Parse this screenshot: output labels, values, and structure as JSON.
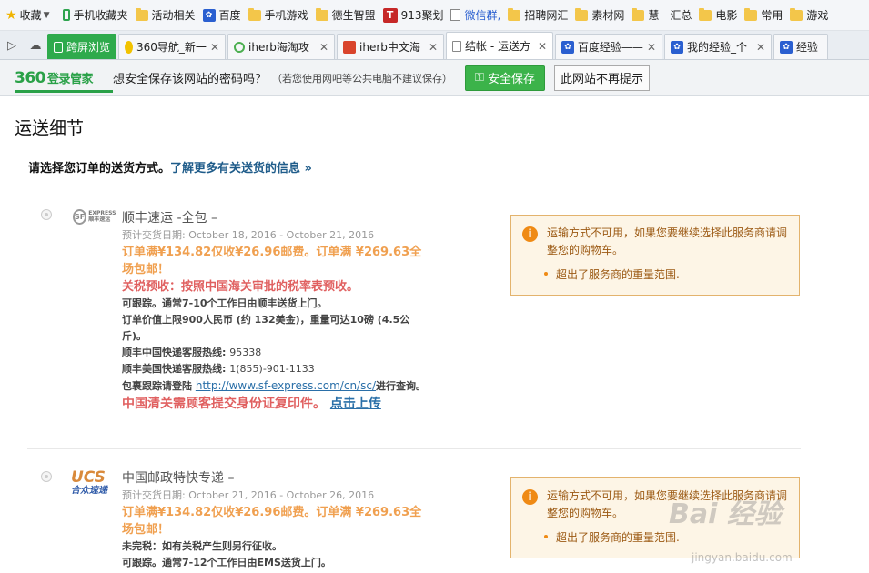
{
  "bookmarks": [
    {
      "label": "收藏",
      "icon": "star-icon"
    },
    {
      "label": "手机收藏夹",
      "icon": "phone-icon"
    },
    {
      "label": "活动相关",
      "icon": "folder-icon"
    },
    {
      "label": "百度",
      "icon": "baidu-paw-icon"
    },
    {
      "label": "手机游戏",
      "icon": "folder-icon"
    },
    {
      "label": "德生智盟",
      "icon": "folder-icon"
    },
    {
      "label": "913聚划",
      "icon": "t-icon"
    },
    {
      "label": "微信群,",
      "icon": "doc-icon"
    },
    {
      "label": "招聘网汇",
      "icon": "folder-icon"
    },
    {
      "label": "素材网",
      "icon": "folder-icon"
    },
    {
      "label": "慧一汇总",
      "icon": "folder-icon"
    },
    {
      "label": "电影",
      "icon": "folder-icon"
    },
    {
      "label": "常用",
      "icon": "folder-icon"
    },
    {
      "label": "游戏",
      "icon": "folder-icon"
    }
  ],
  "tabs": [
    {
      "label": "跨屏浏览"
    },
    {
      "label": "360导航_新一"
    },
    {
      "label": "iherb海淘攻"
    },
    {
      "label": "iherb中文海"
    },
    {
      "label": "结帐 - 运送方"
    },
    {
      "label": "百度经验——"
    },
    {
      "label": "我的经验_个"
    },
    {
      "label": "经验"
    }
  ],
  "password_bar": {
    "brand": "360",
    "brand_sub": "登录管家",
    "message": "想安全保存该网站的密码吗？",
    "note": "（若您使用网吧等公共电脑不建议保存）",
    "save_label": "安全保存",
    "never_label": "此网站不再提示"
  },
  "page": {
    "title": "运送细节",
    "intro": "请选择您订单的送货方式。",
    "intro_link": "了解更多有关送货的信息 »"
  },
  "shipping_options": [
    {
      "name": "顺丰速运 -全包 –",
      "date": "预计交货日期: October 18, 2016 - October 21, 2016",
      "promo": "订单满¥134.82仅收¥26.96邮费。订单满 ¥269.63全场包邮！",
      "tax": "关税预收：按照中国海关审批的税率表预收。",
      "tracking": "可跟踪。通常7-10个工作日由顺丰送货上门。",
      "limit": "订单价值上限900人民币 (约 132美金)，重量可达10磅 (4.5公斤)。",
      "hotline_cn_label": "顺丰中国快递客服热线:",
      "hotline_cn": "95338",
      "hotline_us_label": "顺丰美国快递客服热线:",
      "hotline_us": "1(855)-901-1133",
      "track_prefix": "包裹跟踪请登陆",
      "track_url": "http://www.sf-express.com/cn/sc/",
      "track_suffix": "进行查询。",
      "id_notice": "中国清关需顾客提交身份证复印件。",
      "upload_link": "点击上传",
      "logo_text": "SF",
      "logo_sub": "EXPRESS\n顺丰速运"
    },
    {
      "name": "中国邮政特快专递 –",
      "date": "预计交货日期: October 21, 2016 - October 26, 2016",
      "promo": "订单满¥134.82仅收¥26.96邮费。订单满 ¥269.63全场包邮！",
      "tax": "未完税：如有关税产生则另行征收。",
      "tracking": "可跟踪。通常7-12个工作日由EMS送货上门。",
      "logo_text": "UCS",
      "logo_sub": "合众速递"
    }
  ],
  "warnings": [
    {
      "message": "运输方式不可用，如果您要继续选择此服务商请调整您的购物车。",
      "bullet": "超出了服务商的重量范围."
    },
    {
      "message": "运输方式不可用，如果您要继续选择此服务商请调整您的购物车。",
      "bullet": "超出了服务商的重量范围."
    }
  ],
  "watermark": {
    "main": "Bai 经验",
    "sub": "jingyan.baidu.com"
  },
  "colors": {
    "green": "#3cb34a",
    "orange": "#f0a050",
    "red": "#e06060",
    "link": "#2a6fa8",
    "warn_bg": "#fdf5e6"
  }
}
